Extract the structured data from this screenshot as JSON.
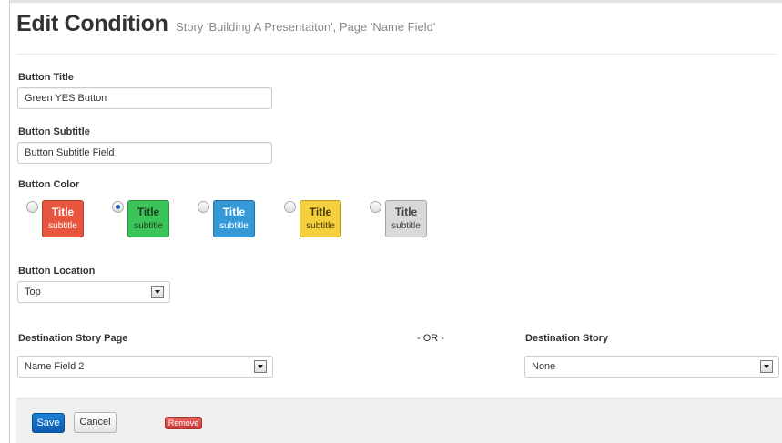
{
  "header": {
    "title": "Edit Condition",
    "subtitle": "Story 'Building A Presentaiton', Page 'Name Field'"
  },
  "form": {
    "button_title": {
      "label": "Button Title",
      "value": "Green YES Button"
    },
    "button_subtitle": {
      "label": "Button Subtitle",
      "value": "Button Subtitle Field"
    },
    "button_color": {
      "label": "Button Color",
      "selected": "green",
      "options": [
        {
          "id": "red",
          "title": "Title",
          "subtitle": "subtitle",
          "color": "#e8553f",
          "text_color": "#ffffff"
        },
        {
          "id": "green",
          "title": "Title",
          "subtitle": "subtitle",
          "color": "#3cc35a",
          "text_color": "#1c3d20"
        },
        {
          "id": "blue",
          "title": "Title",
          "subtitle": "subtitle",
          "color": "#3599d8",
          "text_color": "#ffffff"
        },
        {
          "id": "yellow",
          "title": "Title",
          "subtitle": "subtitle",
          "color": "#f4d03f",
          "text_color": "#4a3a00"
        },
        {
          "id": "gray",
          "title": "Title",
          "subtitle": "subtitle",
          "color": "#d9d9d9",
          "text_color": "#444444"
        }
      ]
    },
    "button_location": {
      "label": "Button Location",
      "value": "Top"
    },
    "destination_page": {
      "label": "Destination Story Page",
      "value": "Name Field 2"
    },
    "or_text": "- OR -",
    "destination_story": {
      "label": "Destination Story",
      "value": "None"
    }
  },
  "footer": {
    "save_label": "Save",
    "cancel_label": "Cancel",
    "remove_label": "Remove"
  },
  "colors": {
    "primary": "#1a73c9",
    "danger": "#d9534f",
    "footer_bg": "#efefef"
  }
}
